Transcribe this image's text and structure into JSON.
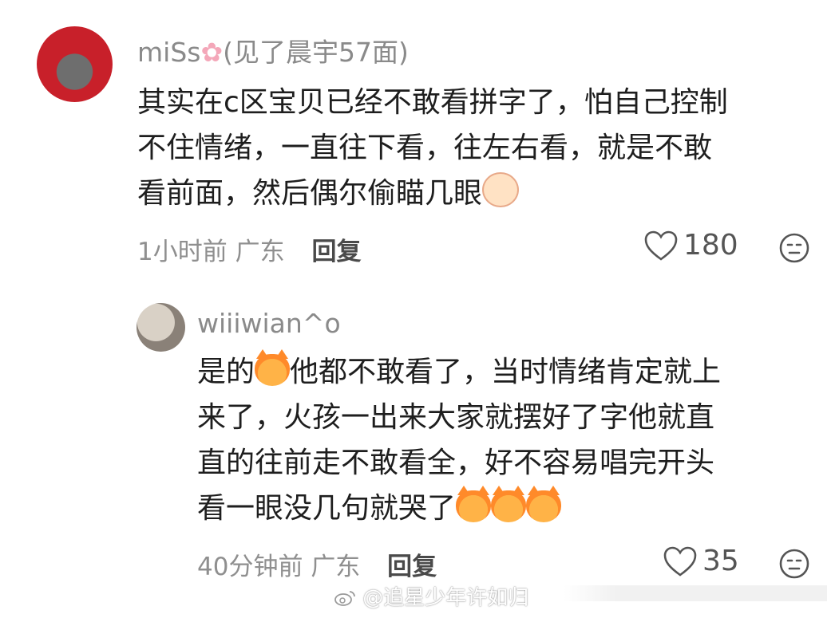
{
  "comment": {
    "username_prefix": "miSs",
    "username_suffix": "(见了晨宇57面)",
    "text_lines": [
      "其实在c区宝贝已经不敢看拼字了，怕自己控制",
      "不住情绪，一直往下看，往左右看，就是不敢",
      "看前面，然后偶尔偷瞄几眼"
    ],
    "time": "1小时前",
    "location": "广东",
    "reply_label": "回复",
    "likes": "180",
    "icons": [
      "heart-icon",
      "dislike-face-icon",
      "crying-emoji-icon",
      "flower-icon"
    ]
  },
  "reply": {
    "username": "wiiiwian^o",
    "text_lines": [
      "是的",
      "他都不敢看了，当时情绪肯定就上",
      "来了，火孩一出来大家就摆好了字他就直",
      "直的往前走不敢看全，好不容易唱完开头",
      "看一眼没几句就哭了"
    ],
    "time": "40分钟前",
    "location": "广东",
    "reply_label": "回复",
    "likes": "35",
    "icons": [
      "heart-icon",
      "dislike-face-icon",
      "crying-cat-emoji-icon"
    ]
  },
  "watermark": {
    "text": "@追星少年许如归"
  },
  "colors": {
    "text": "#1e1e1e",
    "secondary": "#8f8f8f",
    "username": "#8a8a8a"
  }
}
